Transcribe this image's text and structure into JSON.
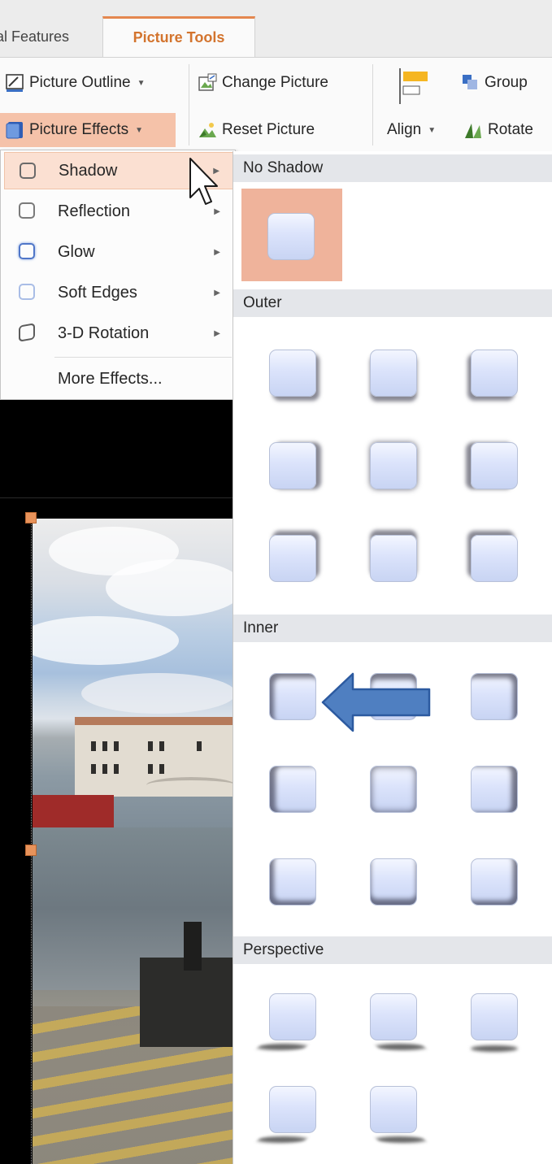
{
  "ribbon": {
    "tabs": [
      {
        "label": "al Features"
      },
      {
        "label": "Picture Tools"
      }
    ],
    "buttons": {
      "picture_outline": "Picture Outline",
      "picture_effects": "Picture Effects",
      "change_picture": "Change Picture",
      "reset_picture": "Reset Picture",
      "align": "Align",
      "group": "Group",
      "rotate": "Rotate"
    }
  },
  "effects_menu": {
    "items": [
      {
        "label": "Shadow",
        "icon": "shadow-icon",
        "submenu": true
      },
      {
        "label": "Reflection",
        "icon": "reflection-icon",
        "submenu": true
      },
      {
        "label": "Glow",
        "icon": "glow-icon",
        "submenu": true
      },
      {
        "label": "Soft Edges",
        "icon": "soft-edges-icon",
        "submenu": true
      },
      {
        "label": "3-D Rotation",
        "icon": "3d-rotation-icon",
        "submenu": true
      }
    ],
    "more": "More Effects..."
  },
  "shadow_gallery": {
    "sections": {
      "none": "No Shadow",
      "outer": "Outer",
      "inner": "Inner",
      "perspective": "Perspective"
    }
  },
  "colors": {
    "accent": "#e4874f",
    "tab_text": "#d3742e",
    "selection": "#efb39b",
    "hover": "#fbe0d2",
    "arrow": "#4472c4",
    "section_header": "#e4e6ea"
  }
}
